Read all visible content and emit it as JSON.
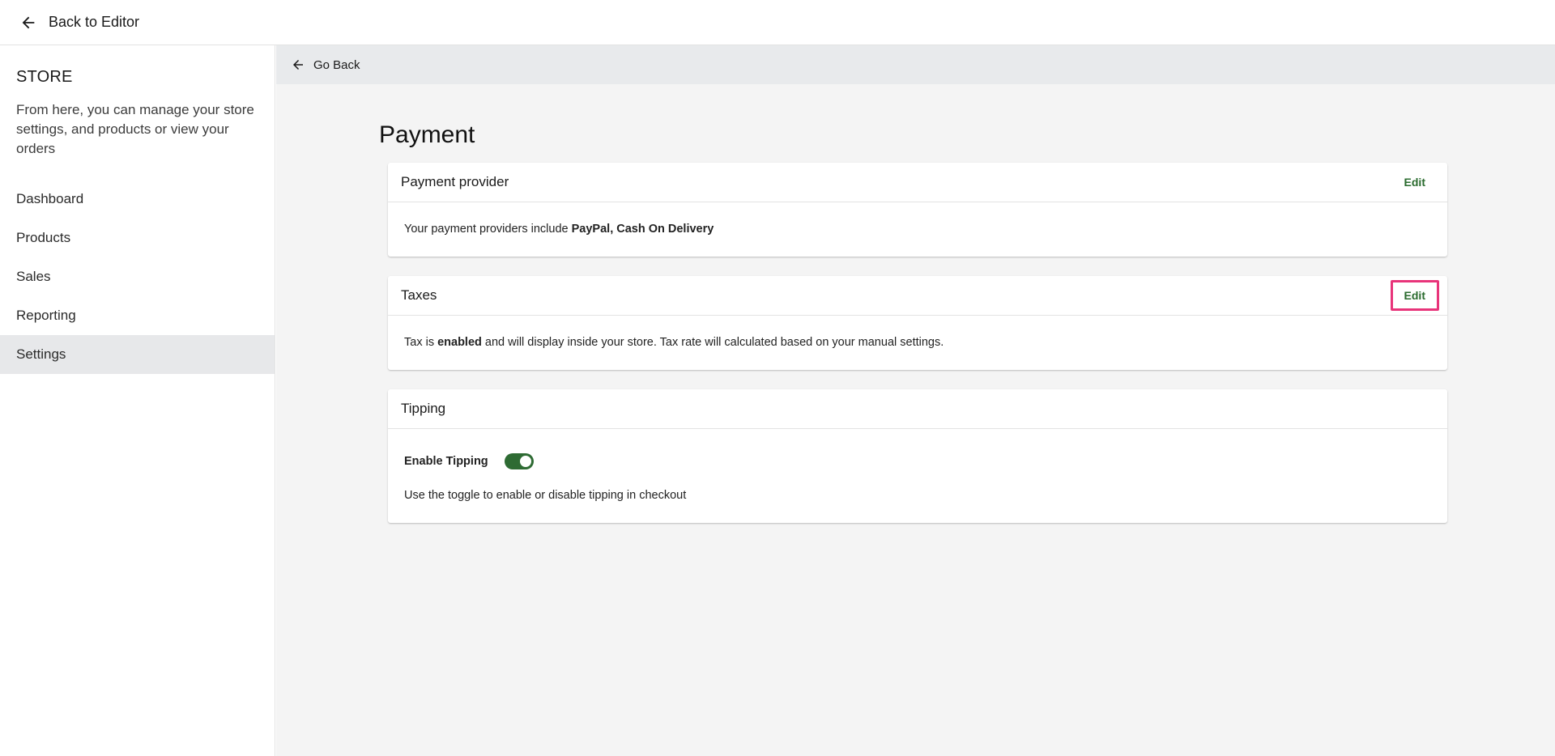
{
  "topbar": {
    "back_label": "Back to Editor"
  },
  "sidebar": {
    "title": "STORE",
    "description": "From here, you can manage your store settings, and products or view your orders",
    "items": [
      {
        "label": "Dashboard",
        "active": false
      },
      {
        "label": "Products",
        "active": false
      },
      {
        "label": "Sales",
        "active": false
      },
      {
        "label": "Reporting",
        "active": false
      },
      {
        "label": "Settings",
        "active": true
      }
    ]
  },
  "main": {
    "go_back_label": "Go Back",
    "page_title": "Payment",
    "payment_provider": {
      "title": "Payment provider",
      "edit_label": "Edit",
      "text_prefix": "Your payment providers include ",
      "providers": "PayPal, Cash On Delivery"
    },
    "taxes": {
      "title": "Taxes",
      "edit_label": "Edit",
      "text_prefix": "Tax is ",
      "status": "enabled",
      "text_suffix": " and will display inside your store. Tax rate will calculated based on your manual settings."
    },
    "tipping": {
      "title": "Tipping",
      "toggle_label": "Enable Tipping",
      "enabled": true,
      "help_text": "Use the toggle to enable or disable tipping in checkout"
    }
  },
  "colors": {
    "accent_green": "#2a6b2e",
    "toggle_on": "#2e6b33",
    "highlight_pink": "#e8347a",
    "sidebar_active": "#e7e8ea"
  }
}
